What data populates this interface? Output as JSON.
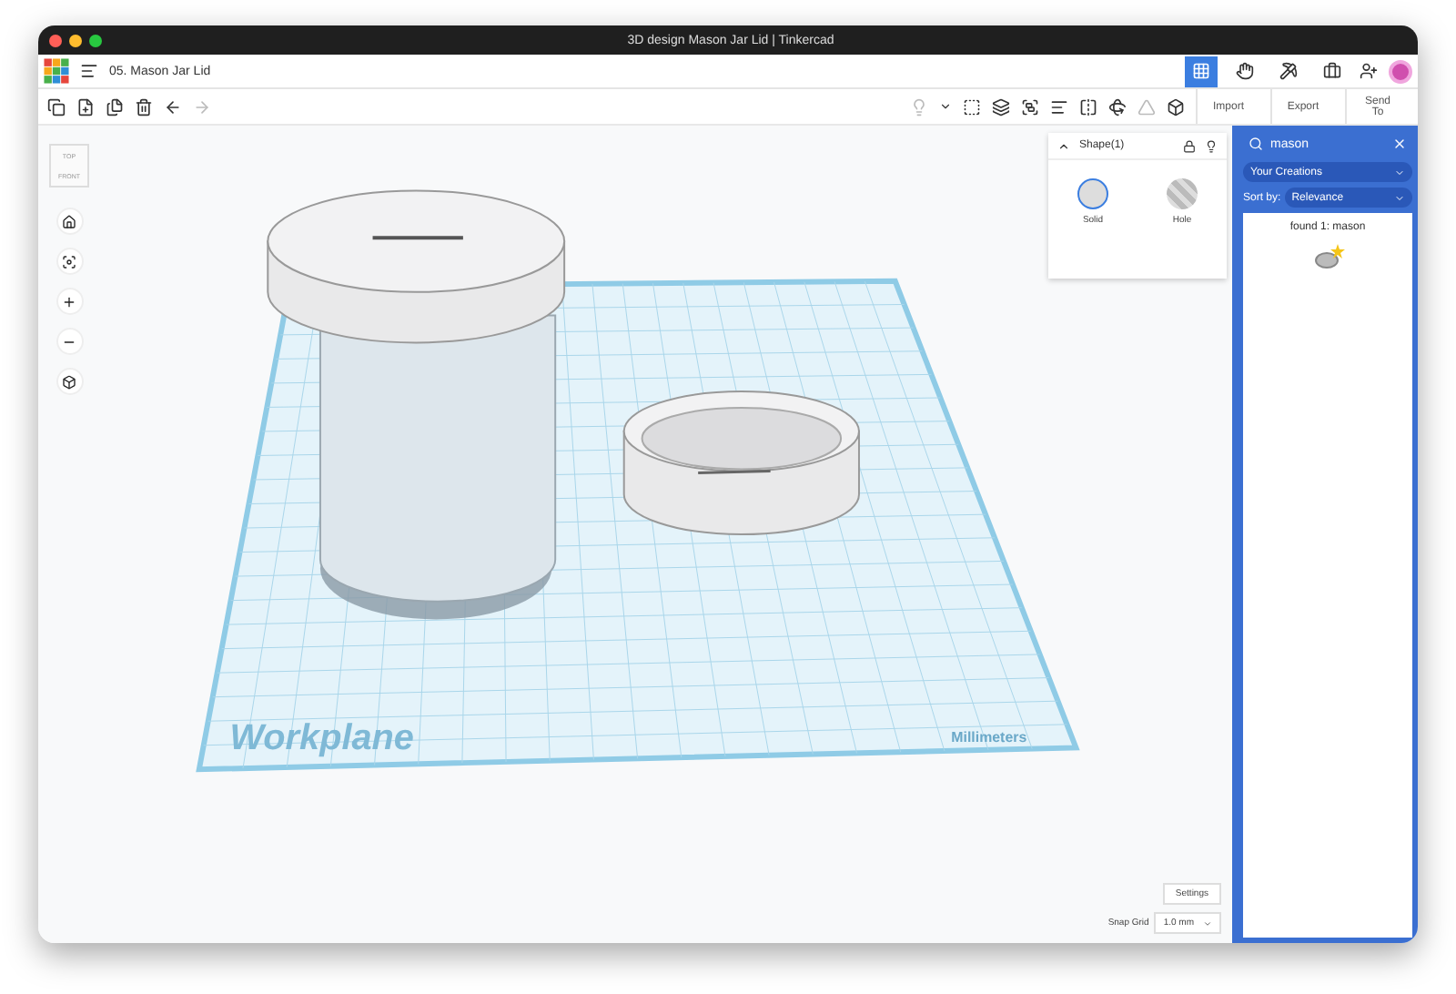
{
  "window": {
    "title": "3D design Mason Jar Lid | Tinkercad"
  },
  "header": {
    "document_name": "05. Mason Jar Lid",
    "views": [
      {
        "kind": "grid",
        "selected": true
      },
      {
        "kind": "hand",
        "selected": false
      },
      {
        "kind": "pickaxe",
        "selected": false
      },
      {
        "kind": "briefcase",
        "selected": false
      }
    ]
  },
  "toolbar": {
    "actions": [
      "Import",
      "Export",
      "Send To"
    ]
  },
  "view_cube": {
    "top": "TOP",
    "front": "FRONT"
  },
  "shape_panel": {
    "title": "Shape(1)",
    "options": [
      {
        "label": "Solid",
        "kind": "solid",
        "selected": true
      },
      {
        "label": "Hole",
        "kind": "hole",
        "selected": false
      }
    ]
  },
  "library": {
    "search": "mason",
    "source": "Your Creations",
    "sort_label": "Sort by:",
    "sort": "Relevance",
    "result_title": "found 1: mason"
  },
  "workplane": {
    "label": "Workplane",
    "units": "Millimeters"
  },
  "footer": {
    "settings": "Settings",
    "snap_label": "Snap Grid",
    "snap_value": "1.0 mm"
  }
}
